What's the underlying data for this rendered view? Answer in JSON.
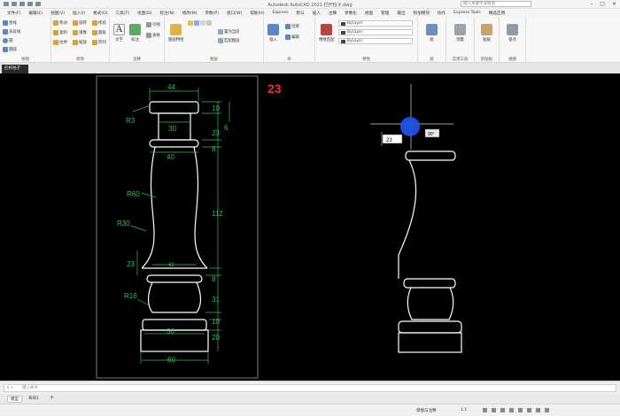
{
  "app": {
    "title": "Autodesk AutoCAD 2021    栏杆柱子.dwg",
    "search_placeholder": "键入关键字或短语"
  },
  "menu": [
    "文件(F)",
    "编辑(E)",
    "视图(V)",
    "插入(I)",
    "格式(O)",
    "工具(T)",
    "绘图(D)",
    "标注(N)",
    "修改(M)",
    "参数(P)",
    "窗口(W)",
    "帮助(H)",
    "Express",
    "默认",
    "插入",
    "注释",
    "参数化",
    "视图",
    "管理",
    "输出",
    "附加模块",
    "协作",
    "Express Tools",
    "精选应用"
  ],
  "ribbon": {
    "draw": {
      "label": "绘图",
      "line": "直线",
      "polyline": "多段线",
      "circle": "圆",
      "arc": "圆弧"
    },
    "modify": {
      "label": "修改",
      "move": "移动",
      "rotate": "旋转",
      "trim": "修剪",
      "copy": "复制",
      "mirror": "镜像",
      "fillet": "圆角",
      "stretch": "拉伸",
      "scale": "缩放",
      "array": "阵列"
    },
    "annotation": {
      "label": "注释",
      "text": "文字",
      "dim": "标注",
      "leader": "引线",
      "table": "表格"
    },
    "layers": {
      "label": "图层",
      "layer_props": "图层特性",
      "make_current": "置为当前",
      "match_layer": "匹配图层"
    },
    "block": {
      "label": "块",
      "insert": "插入",
      "create": "创建",
      "edit": "编辑"
    },
    "properties": {
      "label": "特性",
      "match": "特性匹配",
      "bylayer1": "ByLayer",
      "bylayer2": "ByLayer",
      "bylayer3": "ByLayer"
    },
    "groups": {
      "label": "组",
      "group": "组"
    },
    "utilities": {
      "label": "实用工具",
      "measure": "测量"
    },
    "clipboard": {
      "label": "剪贴板",
      "paste": "粘贴"
    },
    "view": {
      "label": "视图",
      "base": "基点"
    }
  },
  "doc_tab": "栏杆柱子",
  "frame_label": "23",
  "dims": {
    "top_width": "44",
    "r3": "R3",
    "h10a": "10",
    "w30": "30",
    "h23a": "23",
    "h6": "6",
    "h8a": "8",
    "w40": "40",
    "r60": "R60",
    "h112": "112",
    "r30": "R30",
    "h23b": "23",
    "w_small": "41",
    "h8b": "8",
    "h31": "31",
    "r16": "R16",
    "h10b": "10",
    "w50": "50",
    "h20": "20",
    "w60": "60"
  },
  "tooltip": {
    "length": "23",
    "angle": "90°"
  },
  "command_placeholder": "键入命令",
  "layout_tabs": [
    "模型",
    "布局1"
  ],
  "status": {
    "workspace": "草图与注释",
    "scale": "1:1"
  }
}
